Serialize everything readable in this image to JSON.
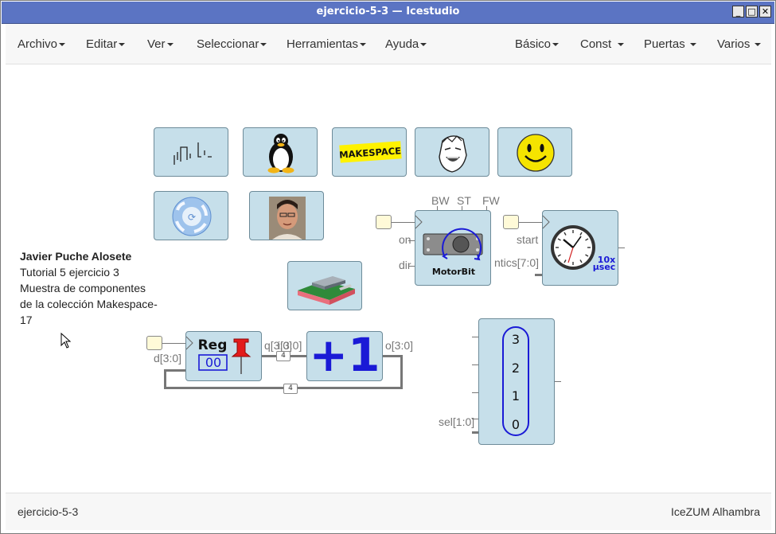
{
  "window": {
    "title": "ejercicio-5-3 — Icestudio"
  },
  "menu": {
    "left": [
      "Archivo",
      "Editar",
      "Ver",
      "Seleccionar",
      "Herramientas",
      "Ayuda"
    ],
    "right": [
      "Básico",
      "Const",
      "Puertas",
      "Varios"
    ]
  },
  "comment": {
    "author": "Javier Puche Alosete",
    "lines": [
      "Tutorial 5 ejercicio 3",
      "Muestra de componentes",
      "de la colección Makespace-",
      "17"
    ]
  },
  "tiles": {
    "makespace_text": "MAKESPACE"
  },
  "motorbit": {
    "top_labels": [
      "BW",
      "ST",
      "FW"
    ],
    "inputs": [
      "on",
      "dir"
    ],
    "name": "MotorBit"
  },
  "timer": {
    "inputs": [
      "start",
      "ntics[7:0]"
    ],
    "badge_top": "10x",
    "badge_bottom": "µsec"
  },
  "reg": {
    "name": "Reg",
    "value": "00",
    "input": "d[3:0]",
    "output": "q[3:0]"
  },
  "inc": {
    "label": "+1",
    "input": "i[3:0]",
    "output": "o[3:0]"
  },
  "buses": [
    "4",
    "4"
  ],
  "mux": {
    "values": [
      "3",
      "2",
      "1",
      "0"
    ],
    "select": "sel[1:0]"
  },
  "footer": {
    "file": "ejercicio-5-3",
    "board": "IceZUM Alhambra"
  },
  "colors": {
    "titlebar": "#5b74c3",
    "block_fill": "#c6dfea",
    "inc_text": "#1a1ad6",
    "reg_pin": "#e31b1b",
    "smiley": "#f5e400"
  }
}
